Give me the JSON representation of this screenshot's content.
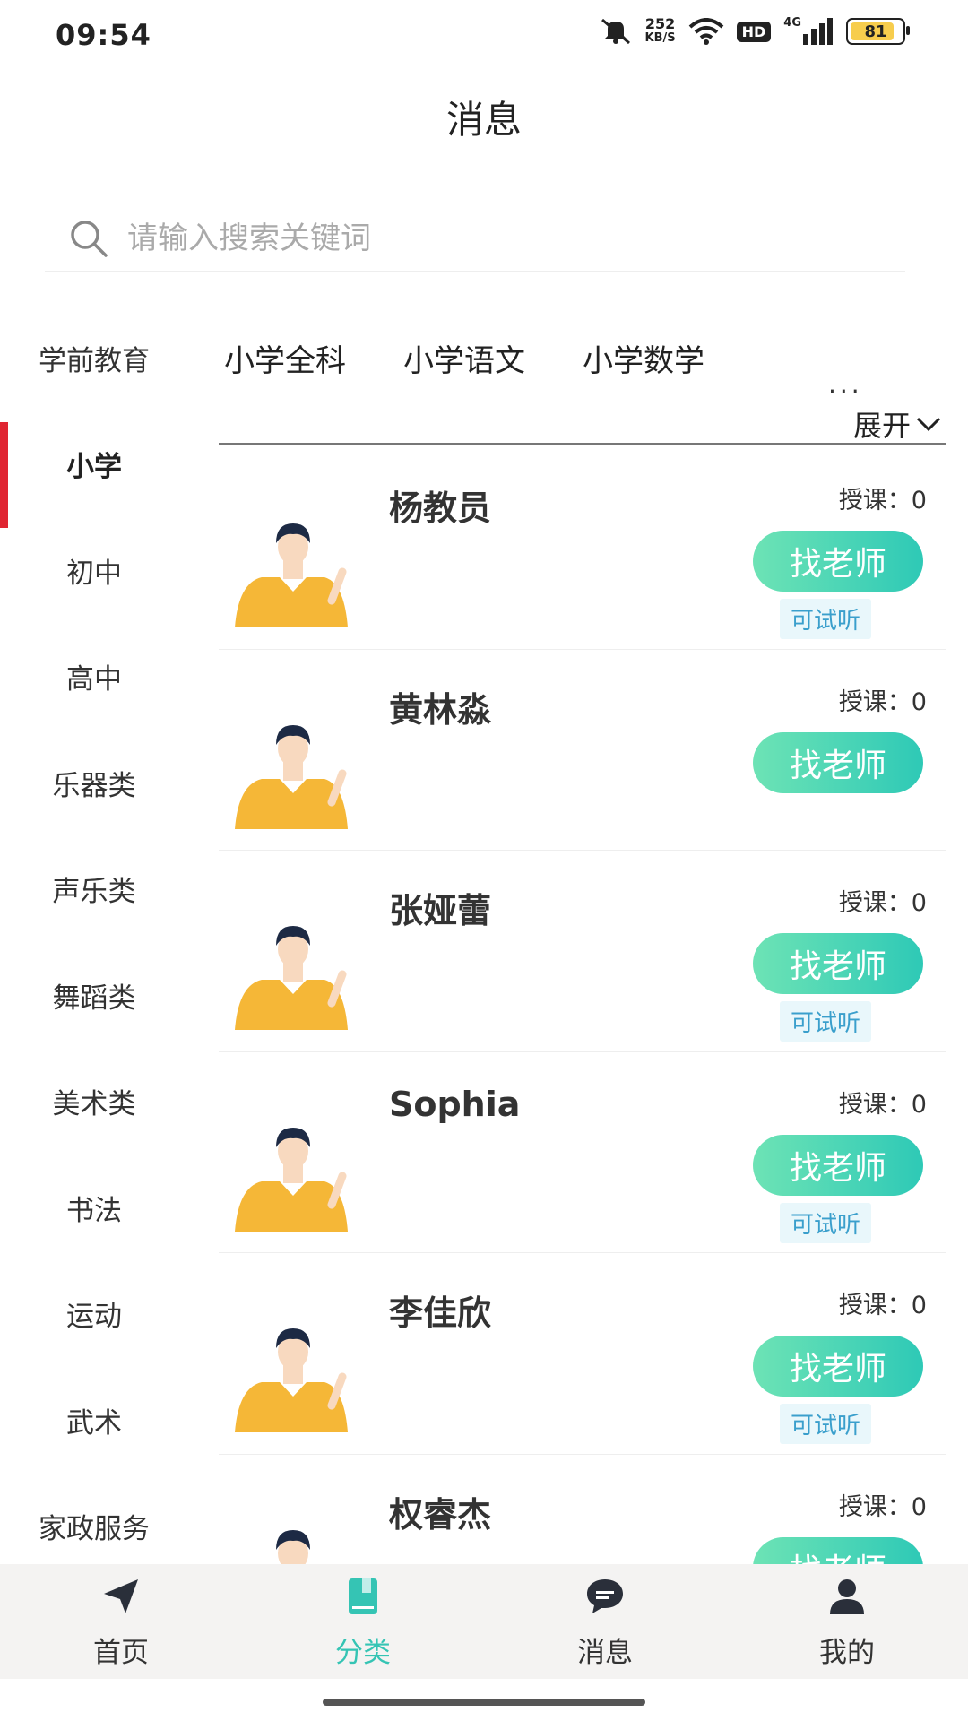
{
  "status_bar": {
    "time": "09:54",
    "net_speed_value": "252",
    "net_speed_unit": "KB/S",
    "hd": "HD",
    "signal": "4G",
    "battery": "81"
  },
  "header": {
    "title": "消息"
  },
  "search": {
    "placeholder": "请输入搜索关键词"
  },
  "left_nav": {
    "items": [
      {
        "label": "学前教育"
      },
      {
        "label": "小学"
      },
      {
        "label": "初中"
      },
      {
        "label": "高中"
      },
      {
        "label": "乐器类"
      },
      {
        "label": "声乐类"
      },
      {
        "label": "舞蹈类"
      },
      {
        "label": "美术类"
      },
      {
        "label": "书法"
      },
      {
        "label": "运动"
      },
      {
        "label": "武术"
      },
      {
        "label": "家政服务"
      }
    ],
    "active_index": 1
  },
  "subcategories": {
    "items": [
      "小学全科",
      "小学语文",
      "小学数学"
    ],
    "more": "...",
    "expand_label": "展开"
  },
  "teachers": [
    {
      "name": "杨教员",
      "lessons": "授课：0",
      "button": "找老师",
      "trial": "可试听"
    },
    {
      "name": "黄林淼",
      "lessons": "授课：0",
      "button": "找老师",
      "trial": ""
    },
    {
      "name": "张娅蕾",
      "lessons": "授课：0",
      "button": "找老师",
      "trial": "可试听"
    },
    {
      "name": "Sophia",
      "lessons": "授课：0",
      "button": "找老师",
      "trial": "可试听"
    },
    {
      "name": "李佳欣",
      "lessons": "授课：0",
      "button": "找老师",
      "trial": "可试听"
    },
    {
      "name": "权睿杰",
      "lessons": "授课：0",
      "button": "找老师",
      "trial": ""
    }
  ],
  "tabbar": {
    "items": [
      {
        "label": "首页",
        "icon": "send-icon"
      },
      {
        "label": "分类",
        "icon": "book-icon"
      },
      {
        "label": "消息",
        "icon": "chat-icon"
      },
      {
        "label": "我的",
        "icon": "user-icon"
      }
    ],
    "active_index": 1
  },
  "colors": {
    "accent": "#35c4b4",
    "active_nav_bar": "#e02532",
    "button_gradient_start": "#6de3b5",
    "button_gradient_end": "#2ec9b6"
  }
}
